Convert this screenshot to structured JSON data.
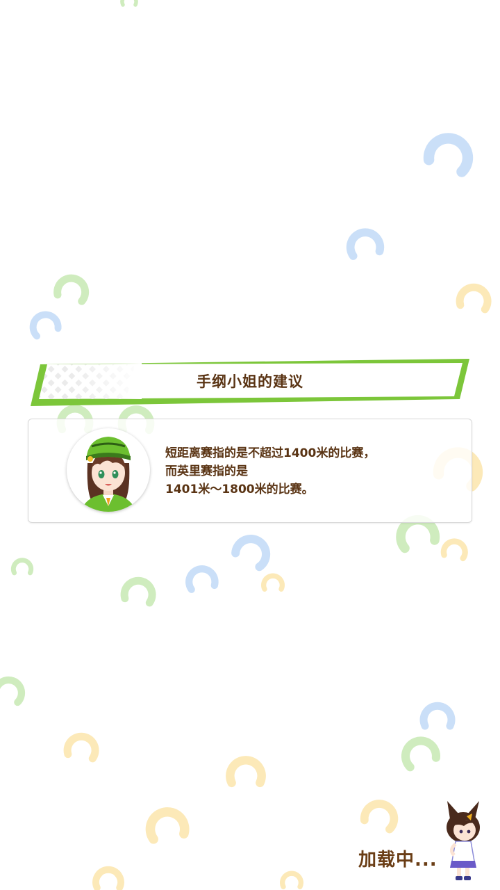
{
  "banner": {
    "title": "手纲小姐的建议"
  },
  "advice": {
    "speaker_icon": "green-hat-guide-avatar",
    "lines": [
      "短距离赛指的是不超过1400米的比赛，",
      "而英里赛指的是",
      "1401米～1800米的比赛。"
    ]
  },
  "loading": {
    "label": "加载中..."
  },
  "colors": {
    "banner_green": "#7cc63a",
    "text_brown": "#5a3414",
    "shoe_blue": "#b8d4f5",
    "shoe_green": "#bfe6a8",
    "shoe_yellow": "#fbe1a0"
  }
}
